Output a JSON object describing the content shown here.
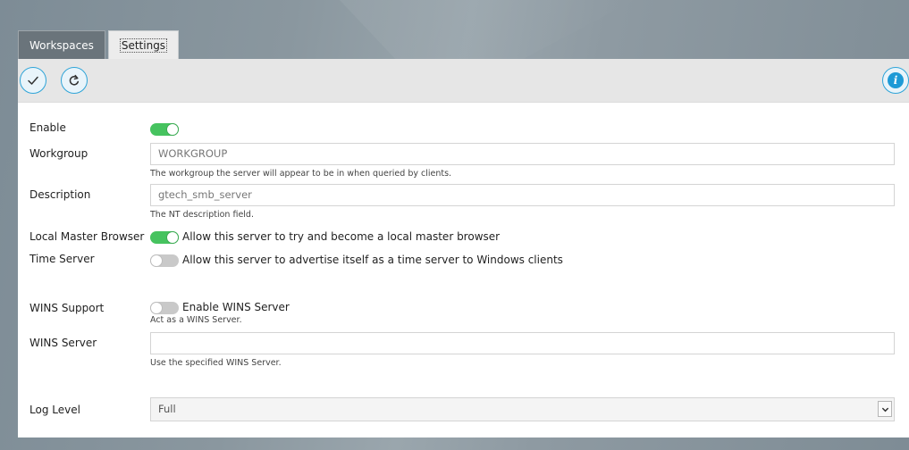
{
  "tabs": [
    {
      "label": "Workspaces",
      "active": false
    },
    {
      "label": "Settings",
      "active": true
    }
  ],
  "toolbar": {
    "ok_icon": "check-icon",
    "refresh_icon": "refresh-icon",
    "info_icon": "info-icon",
    "info_glyph": "i"
  },
  "form": {
    "enable": {
      "label": "Enable",
      "on": true
    },
    "workgroup": {
      "label": "Workgroup",
      "value": "WORKGROUP",
      "help": "The workgroup the server will appear to be in when queried by clients."
    },
    "description": {
      "label": "Description",
      "value": "gtech_smb_server",
      "help": "The NT description field."
    },
    "local_master": {
      "label": "Local Master Browser",
      "on": true,
      "text": "Allow this server to try and become a local master browser"
    },
    "time_server": {
      "label": "Time Server",
      "on": false,
      "text": "Allow this server to advertise itself as a time server to Windows clients"
    },
    "wins_support": {
      "label": "WINS Support",
      "on": false,
      "text": "Enable WINS Server",
      "help": "Act as a WINS Server."
    },
    "wins_server": {
      "label": "WINS Server",
      "value": "",
      "help": "Use the specified WINS Server."
    },
    "log_level": {
      "label": "Log Level",
      "value": "Full"
    }
  },
  "colors": {
    "toggle_on": "#46c35f",
    "toggle_off": "#c9c9c9",
    "accent": "#1e9ad6"
  }
}
